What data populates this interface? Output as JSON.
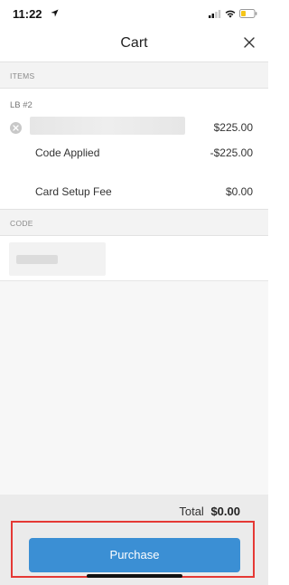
{
  "status_bar": {
    "time": "11:22"
  },
  "nav": {
    "title": "Cart"
  },
  "items_section": {
    "header": "ITEMS",
    "lb_label": "LB #2",
    "line_item_price": "$225.00",
    "code_applied_label": "Code Applied",
    "code_applied_value": "-$225.00",
    "card_fee_label": "Card Setup Fee",
    "card_fee_value": "$0.00"
  },
  "code_section": {
    "header": "CODE"
  },
  "footer": {
    "total_label": "Total",
    "total_value": "$0.00",
    "purchase_label": "Purchase"
  },
  "colors": {
    "accent": "#3b8fd4",
    "highlight": "#e53935",
    "battery": "#f5c518"
  }
}
